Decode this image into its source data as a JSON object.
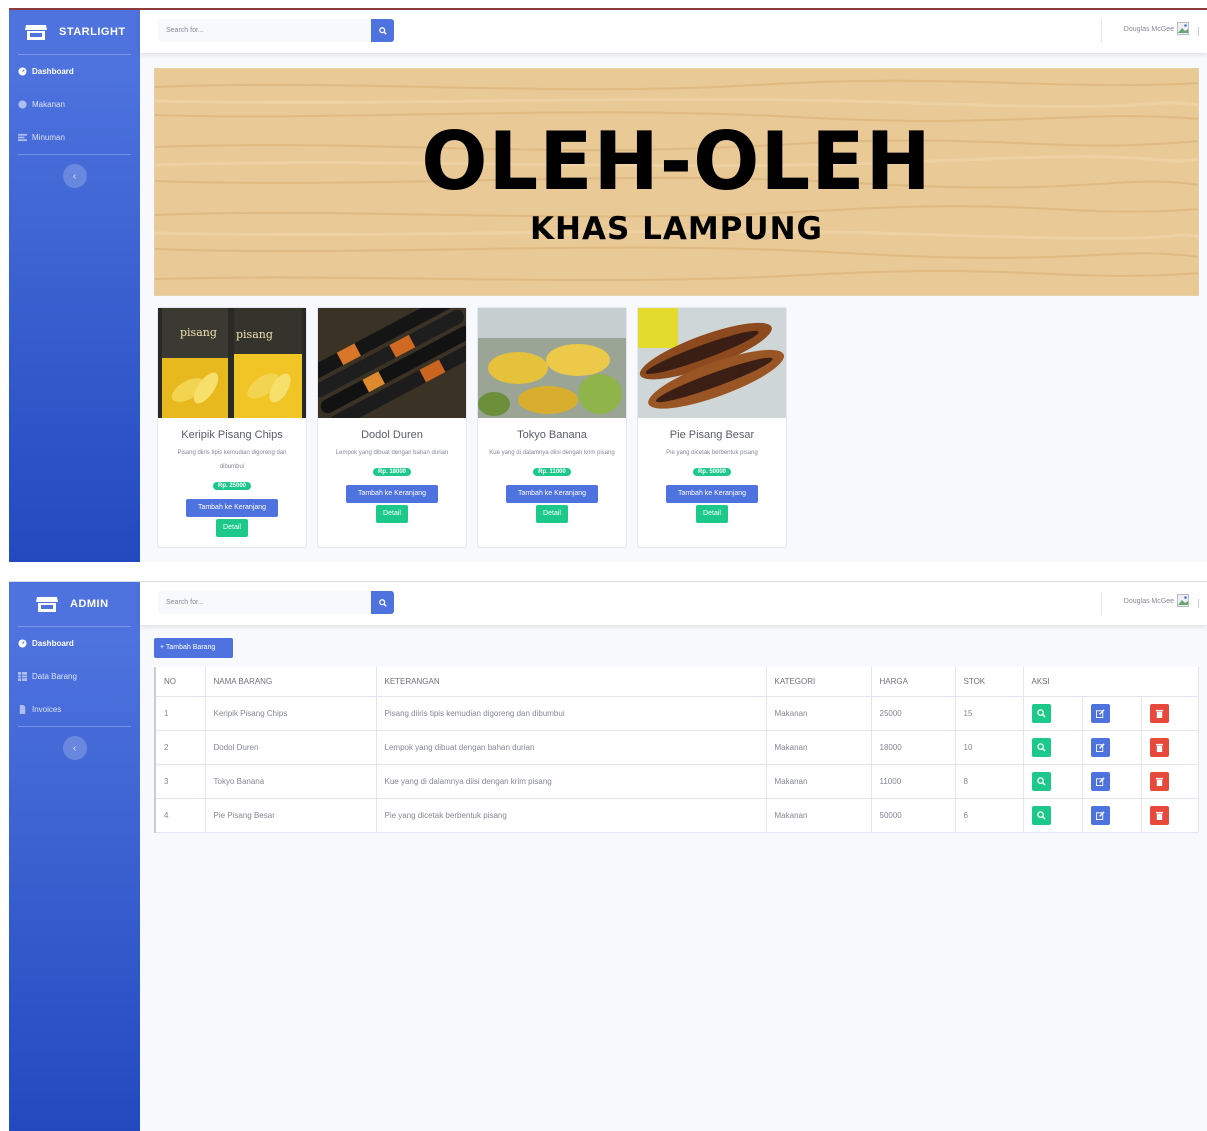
{
  "screen1": {
    "brand": "STARLIGHT",
    "nav": [
      {
        "label": "Dashboard",
        "icon": "tachometer-icon"
      },
      {
        "label": "Makanan",
        "icon": "circle-icon"
      },
      {
        "label": "Minuman",
        "icon": "list-icon"
      }
    ],
    "search_placeholder": "Search for...",
    "user_name": "Douglas McGee",
    "banner": {
      "title": "OLEH-OLEH",
      "subtitle": "KHAS LAMPUNG"
    },
    "products": [
      {
        "name": "Keripik Pisang Chips",
        "desc": "Pisang diiris tipis kemudian digoreng dan dibumbui",
        "price": "Rp. 25000"
      },
      {
        "name": "Dodol Duren",
        "desc": "Lempok yang dibuat dengan bahan durian",
        "price": "Rp. 18000"
      },
      {
        "name": "Tokyo Banana",
        "desc": "Kue yang di dalamnya diisi dengan krim pisang",
        "price": "Rp. 11000"
      },
      {
        "name": "Pie Pisang Besar",
        "desc": "Pie yang dicetak berbentuk pisang",
        "price": "Rp. 50000"
      }
    ],
    "cart_label": "Tambah ke Keranjang",
    "detail_label": "Detail"
  },
  "screen2": {
    "brand": "ADMIN",
    "nav": [
      {
        "label": "Dashboard",
        "icon": "tachometer-icon"
      },
      {
        "label": "Data Barang",
        "icon": "table-icon"
      },
      {
        "label": "Invoices",
        "icon": "file-icon"
      }
    ],
    "search_placeholder": "Search for...",
    "user_name": "Douglas McGee",
    "add_label": "+ Tambah Barang",
    "table": {
      "headers": [
        "NO",
        "NAMA BARANG",
        "KETERANGAN",
        "KATEGORI",
        "HARGA",
        "STOK",
        "AKSI"
      ],
      "rows": [
        [
          "1",
          "Keripik Pisang Chips",
          "Pisang diiris tipis kemudian digoreng dan dibumbui",
          "Makanan",
          "25000",
          "15"
        ],
        [
          "2",
          "Dodol Duren",
          "Lempok yang dibuat dengan bahan durian",
          "Makanan",
          "18000",
          "10"
        ],
        [
          "3",
          "Tokyo Banana",
          "Kue yang di dalamnya diisi dengan krim pisang",
          "Makanan",
          "11000",
          "8"
        ],
        [
          "4",
          "Pie Pisang Besar",
          "Pie yang dicetak berbentuk pisang",
          "Makanan",
          "50000",
          "6"
        ]
      ]
    }
  },
  "colors": {
    "primary": "#4e73df",
    "success": "#1cc88a",
    "danger": "#e74a3b",
    "text_muted": "#858796"
  }
}
